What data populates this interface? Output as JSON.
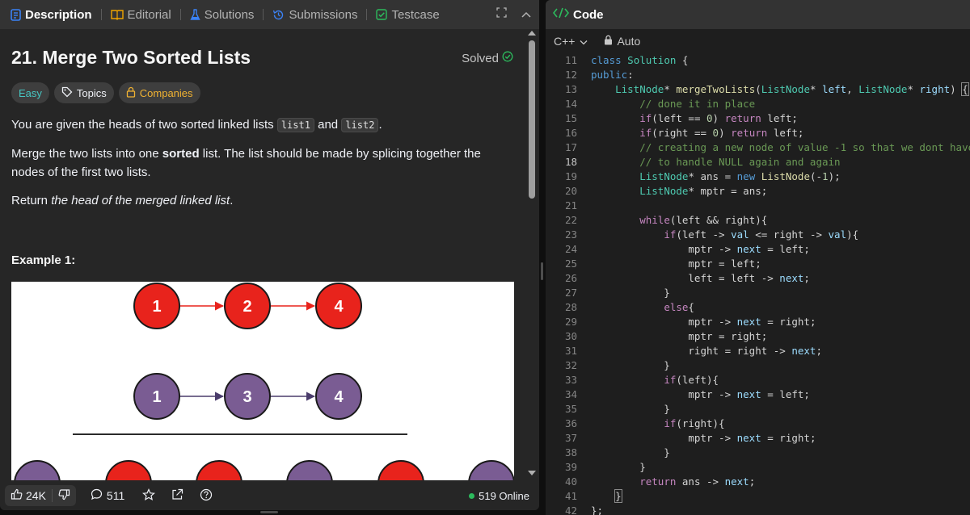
{
  "tabs": [
    {
      "label": "Description",
      "active": true
    },
    {
      "label": "Editorial"
    },
    {
      "label": "Solutions"
    },
    {
      "label": "Submissions"
    },
    {
      "label": "Testcase"
    }
  ],
  "problem": {
    "title": "21. Merge Two Sorted Lists",
    "status": "Solved",
    "difficulty": "Easy",
    "topics_label": "Topics",
    "companies_label": "Companies",
    "para1_pre": "You are given the heads of two sorted linked lists ",
    "para1_code1": "list1",
    "para1_mid": " and ",
    "para1_code2": "list2",
    "para1_post": ".",
    "para2_pre": "Merge the two lists into one ",
    "para2_bold": "sorted",
    "para2_post": " list. The list should be made by splicing together the nodes of the first two lists.",
    "para3_pre": "Return ",
    "para3_em": "the head of the merged linked list",
    "para3_post": ".",
    "example_title": "Example 1:",
    "figure": {
      "list1": [
        "1",
        "2",
        "4"
      ],
      "list2": [
        "1",
        "3",
        "4"
      ],
      "colors": {
        "red": "#e8231c",
        "purple": "#7a5c93",
        "arrow_red": "#e8231c",
        "arrow_purple": "#4a3c6b",
        "stroke": "#1a1a1a"
      }
    }
  },
  "footer": {
    "likes": "24K",
    "comments": "511",
    "online": "519 Online"
  },
  "editor": {
    "tab_label": "Code",
    "language": "C++",
    "mode": "Auto",
    "current_line": 18,
    "lines": [
      {
        "n": "11",
        "tokens": [
          [
            "kw",
            "class"
          ],
          [
            "p",
            " "
          ],
          [
            "ty",
            "Solution"
          ],
          [
            "p",
            " {"
          ]
        ]
      },
      {
        "n": "12",
        "tokens": [
          [
            "kw",
            "public"
          ],
          [
            "p",
            ":"
          ]
        ]
      },
      {
        "n": "13",
        "tokens": [
          [
            "p",
            "    "
          ],
          [
            "ty",
            "ListNode"
          ],
          [
            "p",
            "* "
          ],
          [
            "fn",
            "mergeTwoLists"
          ],
          [
            "p",
            "("
          ],
          [
            "ty",
            "ListNode"
          ],
          [
            "p",
            "* "
          ],
          [
            "var",
            "left"
          ],
          [
            "p",
            ", "
          ],
          [
            "ty",
            "ListNode"
          ],
          [
            "p",
            "* "
          ],
          [
            "var",
            "right"
          ],
          [
            "p",
            ") "
          ],
          [
            "bk",
            "{"
          ]
        ]
      },
      {
        "n": "14",
        "tokens": [
          [
            "p",
            "        "
          ],
          [
            "cm",
            "// done it in place"
          ]
        ]
      },
      {
        "n": "15",
        "tokens": [
          [
            "p",
            "        "
          ],
          [
            "ctl",
            "if"
          ],
          [
            "p",
            "(left == "
          ],
          [
            "nm",
            "0"
          ],
          [
            "p",
            ") "
          ],
          [
            "ctl",
            "return"
          ],
          [
            "p",
            " left;"
          ]
        ]
      },
      {
        "n": "16",
        "tokens": [
          [
            "p",
            "        "
          ],
          [
            "ctl",
            "if"
          ],
          [
            "p",
            "(right == "
          ],
          [
            "nm",
            "0"
          ],
          [
            "p",
            ") "
          ],
          [
            "ctl",
            "return"
          ],
          [
            "p",
            " left;"
          ]
        ]
      },
      {
        "n": "17",
        "tokens": [
          [
            "p",
            "        "
          ],
          [
            "cm",
            "// creating a new node of value -1 so that we dont have"
          ]
        ]
      },
      {
        "n": "18",
        "tokens": [
          [
            "p",
            "        "
          ],
          [
            "cm",
            "// to handle NULL again and again"
          ]
        ]
      },
      {
        "n": "19",
        "tokens": [
          [
            "p",
            "        "
          ],
          [
            "ty",
            "ListNode"
          ],
          [
            "p",
            "* ans = "
          ],
          [
            "kw",
            "new"
          ],
          [
            "p",
            " "
          ],
          [
            "fn",
            "ListNode"
          ],
          [
            "p",
            "(-"
          ],
          [
            "nm",
            "1"
          ],
          [
            "p",
            ");"
          ]
        ]
      },
      {
        "n": "20",
        "tokens": [
          [
            "p",
            "        "
          ],
          [
            "ty",
            "ListNode"
          ],
          [
            "p",
            "* mptr = ans;"
          ]
        ]
      },
      {
        "n": "21",
        "tokens": []
      },
      {
        "n": "22",
        "tokens": [
          [
            "p",
            "        "
          ],
          [
            "ctl",
            "while"
          ],
          [
            "p",
            "(left && right){"
          ]
        ]
      },
      {
        "n": "23",
        "tokens": [
          [
            "p",
            "            "
          ],
          [
            "ctl",
            "if"
          ],
          [
            "p",
            "(left -> "
          ],
          [
            "var",
            "val"
          ],
          [
            "p",
            " <= right -> "
          ],
          [
            "var",
            "val"
          ],
          [
            "p",
            "){"
          ]
        ]
      },
      {
        "n": "24",
        "tokens": [
          [
            "p",
            "                mptr -> "
          ],
          [
            "var",
            "next"
          ],
          [
            "p",
            " = left;"
          ]
        ]
      },
      {
        "n": "25",
        "tokens": [
          [
            "p",
            "                mptr = left;"
          ]
        ]
      },
      {
        "n": "26",
        "tokens": [
          [
            "p",
            "                left = left -> "
          ],
          [
            "var",
            "next"
          ],
          [
            "p",
            ";"
          ]
        ]
      },
      {
        "n": "27",
        "tokens": [
          [
            "p",
            "            }"
          ]
        ]
      },
      {
        "n": "28",
        "tokens": [
          [
            "p",
            "            "
          ],
          [
            "ctl",
            "else"
          ],
          [
            "p",
            "{"
          ]
        ]
      },
      {
        "n": "29",
        "tokens": [
          [
            "p",
            "                mptr -> "
          ],
          [
            "var",
            "next"
          ],
          [
            "p",
            " = right;"
          ]
        ]
      },
      {
        "n": "30",
        "tokens": [
          [
            "p",
            "                mptr = right;"
          ]
        ]
      },
      {
        "n": "31",
        "tokens": [
          [
            "p",
            "                right = right -> "
          ],
          [
            "var",
            "next"
          ],
          [
            "p",
            ";"
          ]
        ]
      },
      {
        "n": "32",
        "tokens": [
          [
            "p",
            "            }"
          ]
        ]
      },
      {
        "n": "33",
        "tokens": [
          [
            "p",
            "            "
          ],
          [
            "ctl",
            "if"
          ],
          [
            "p",
            "(left){"
          ]
        ]
      },
      {
        "n": "34",
        "tokens": [
          [
            "p",
            "                mptr -> "
          ],
          [
            "var",
            "next"
          ],
          [
            "p",
            " = left;"
          ]
        ]
      },
      {
        "n": "35",
        "tokens": [
          [
            "p",
            "            }"
          ]
        ]
      },
      {
        "n": "36",
        "tokens": [
          [
            "p",
            "            "
          ],
          [
            "ctl",
            "if"
          ],
          [
            "p",
            "(right){"
          ]
        ]
      },
      {
        "n": "37",
        "tokens": [
          [
            "p",
            "                mptr -> "
          ],
          [
            "var",
            "next"
          ],
          [
            "p",
            " = right;"
          ]
        ]
      },
      {
        "n": "38",
        "tokens": [
          [
            "p",
            "            }"
          ]
        ]
      },
      {
        "n": "39",
        "tokens": [
          [
            "p",
            "        }"
          ]
        ]
      },
      {
        "n": "40",
        "tokens": [
          [
            "p",
            "        "
          ],
          [
            "ctl",
            "return"
          ],
          [
            "p",
            " ans -> "
          ],
          [
            "var",
            "next"
          ],
          [
            "p",
            ";"
          ]
        ]
      },
      {
        "n": "41",
        "tokens": [
          [
            "p",
            "    "
          ],
          [
            "bk",
            "}"
          ]
        ]
      },
      {
        "n": "42",
        "tokens": [
          [
            "p",
            "};"
          ]
        ]
      }
    ]
  }
}
